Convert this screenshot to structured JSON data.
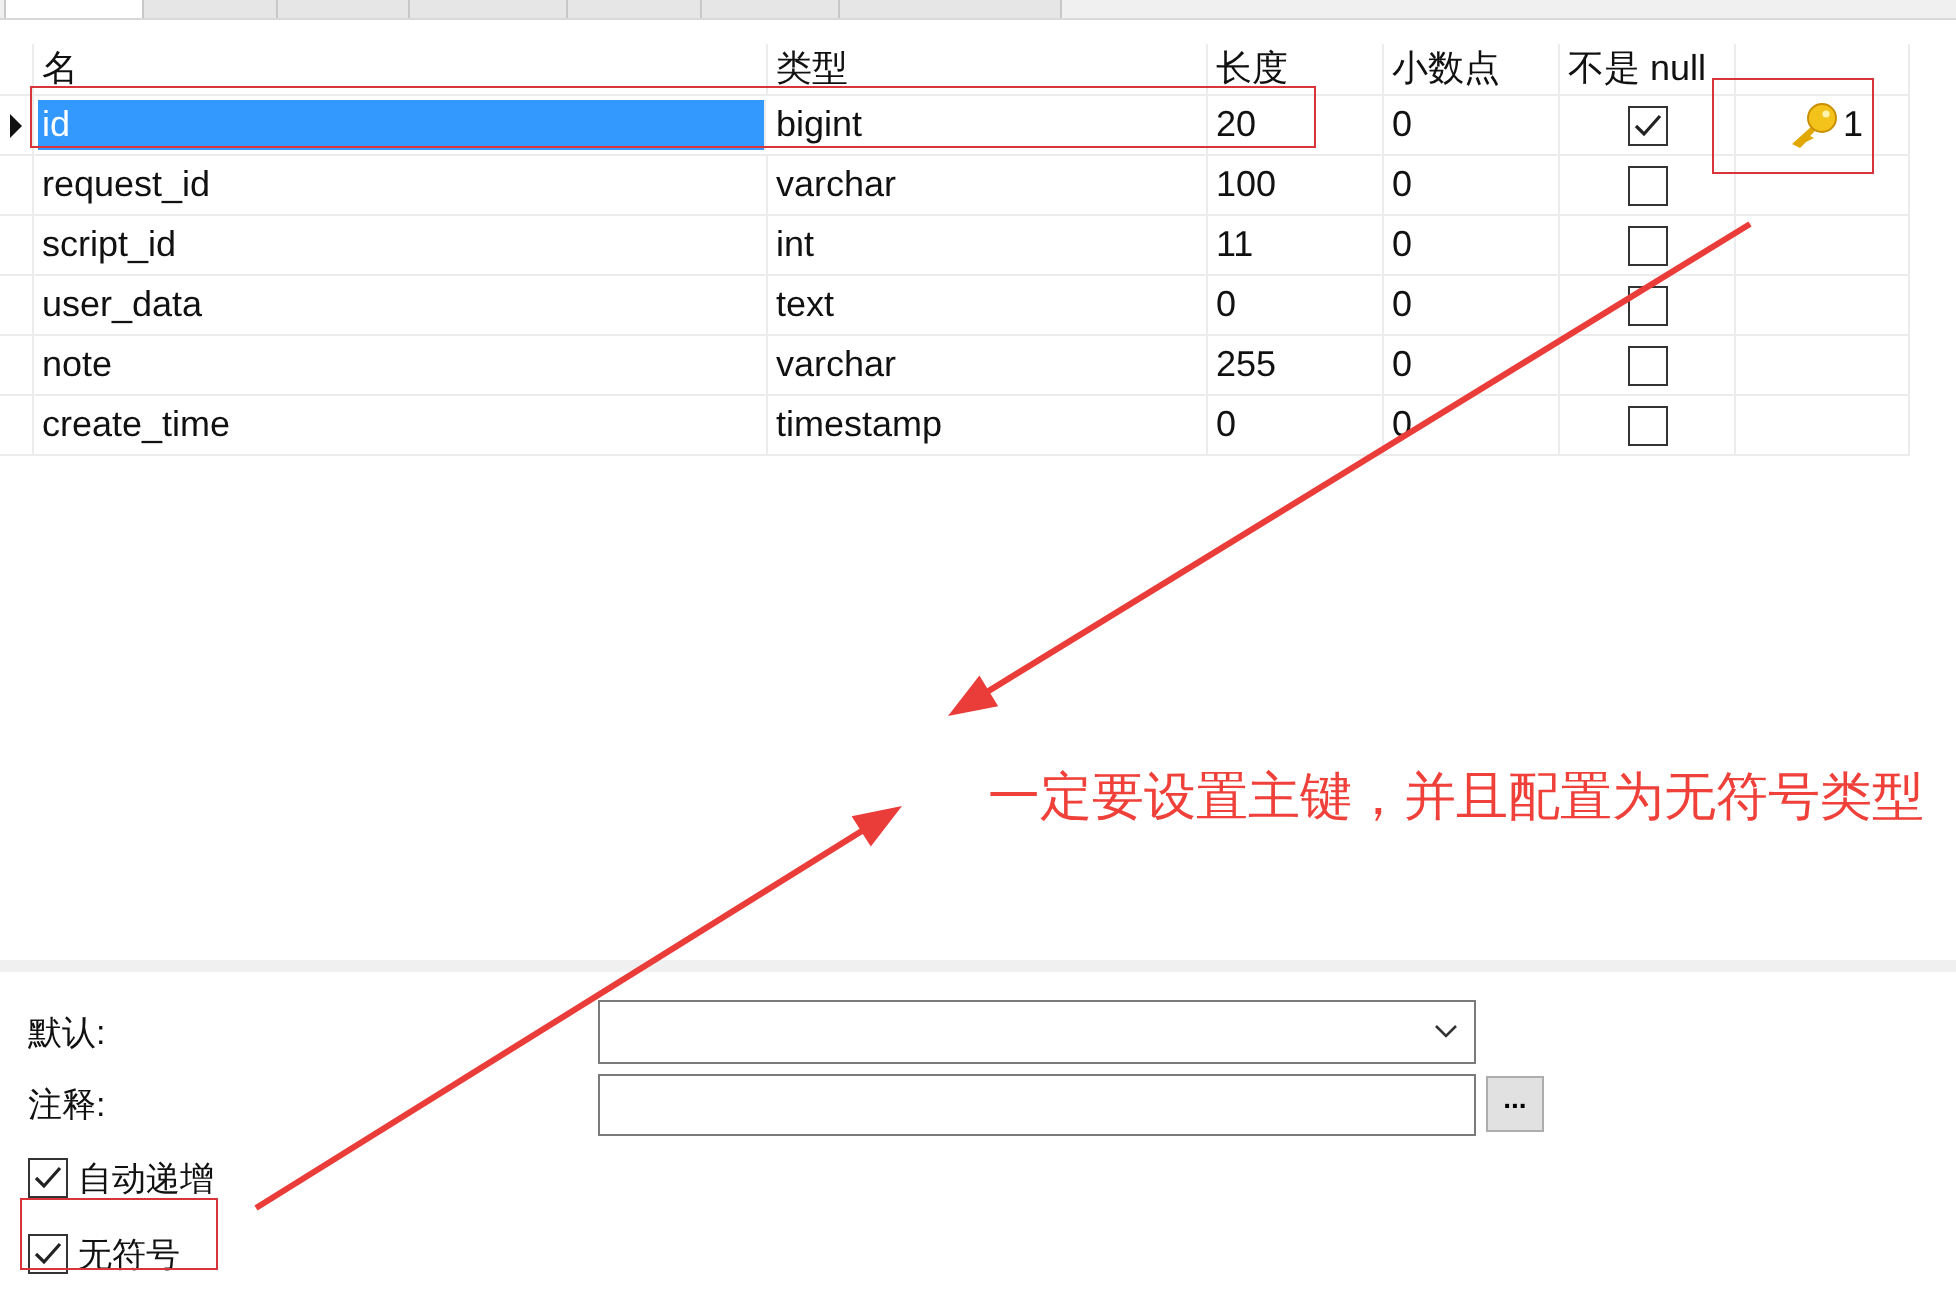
{
  "tabs": [
    {
      "selected": true
    },
    {
      "selected": false
    },
    {
      "selected": false
    },
    {
      "selected": false
    },
    {
      "selected": false
    },
    {
      "selected": false
    },
    {
      "selected": false
    }
  ],
  "columns": [
    "名",
    "类型",
    "长度",
    "小数点",
    "不是 null"
  ],
  "rows": [
    {
      "name": "id",
      "type": "bigint",
      "length": "20",
      "decimals": "0",
      "not_null": true,
      "key": "1",
      "selected": true
    },
    {
      "name": "request_id",
      "type": "varchar",
      "length": "100",
      "decimals": "0",
      "not_null": false,
      "selected": false
    },
    {
      "name": "script_id",
      "type": "int",
      "length": "11",
      "decimals": "0",
      "not_null": false,
      "selected": false
    },
    {
      "name": "user_data",
      "type": "text",
      "length": "0",
      "decimals": "0",
      "not_null": false,
      "selected": false
    },
    {
      "name": "note",
      "type": "varchar",
      "length": "255",
      "decimals": "0",
      "not_null": false,
      "selected": false
    },
    {
      "name": "create_time",
      "type": "timestamp",
      "length": "0",
      "decimals": "0",
      "not_null": false,
      "selected": false
    }
  ],
  "default_label": "默认:",
  "comment_label": "注释:",
  "comment_button": "...",
  "options": [
    {
      "label": "自动递增",
      "checked": true
    },
    {
      "label": "无符号",
      "checked": true
    }
  ],
  "annotation": "一定要设置主键，并且配置为无符号类型"
}
